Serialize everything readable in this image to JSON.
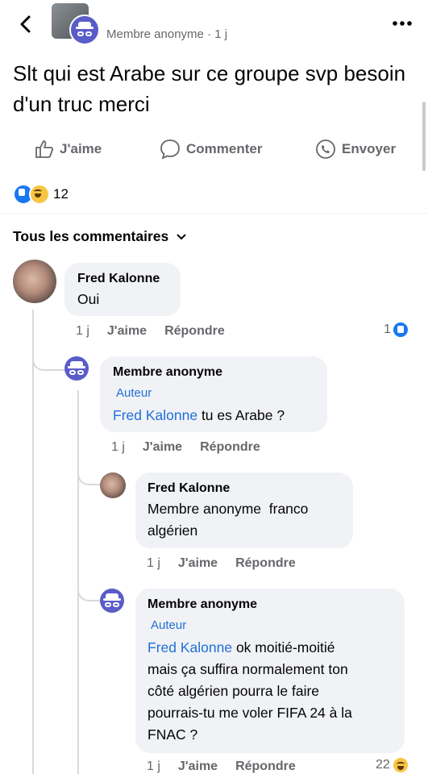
{
  "header": {
    "poster": "Membre anonyme",
    "meta_suffix": "· 1 j"
  },
  "post": {
    "text": "Slt qui est Arabe sur ce groupe svp besoin d'un truc merci"
  },
  "actions": {
    "like": "J'aime",
    "comment": "Commenter",
    "send": "Envoyer"
  },
  "reactions": {
    "count": "12"
  },
  "filter": {
    "label": "Tous les commentaires"
  },
  "comments": [
    {
      "name": "Fred Kalonne",
      "text": "Oui",
      "time": "1 j",
      "like": "J'aime",
      "reply": "Répondre",
      "reactions": "1"
    },
    {
      "name": "Membre anonyme",
      "badge": "Auteur",
      "mention": "Fred Kalonne",
      "text": " tu es Arabe ?",
      "time": "1 j",
      "like": "J'aime",
      "reply": "Répondre"
    },
    {
      "name": "Fred Kalonne",
      "text_line1": "Membre anonyme  franco",
      "text_line2": "algérien",
      "time": "1 j",
      "like": "J'aime",
      "reply": "Répondre"
    },
    {
      "name": "Membre anonyme",
      "badge": "Auteur",
      "mention": "Fred Kalonne",
      "line1": " ok moitié-moitié",
      "line2": "mais ça suffira normalement ton",
      "line3": "côté algérien pourra le faire",
      "line4": "pourrais-tu me voler FIFA 24 à la",
      "line5": "FNAC ?",
      "time": "1 j",
      "like": "J'aime",
      "reply": "Répondre",
      "reactions": "22"
    }
  ],
  "colors": {
    "accent": "#216fdb",
    "bubble": "#f0f2f5",
    "muted": "#65676b"
  }
}
